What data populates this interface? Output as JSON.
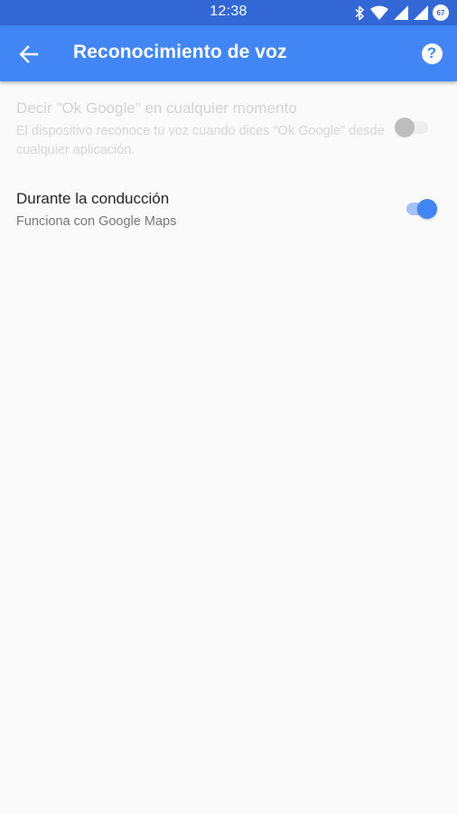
{
  "status_bar": {
    "time": "12:38",
    "battery_level": "67",
    "icons": [
      "bluetooth-icon",
      "wifi-icon",
      "signal-icon",
      "signal-icon",
      "battery-icon"
    ]
  },
  "app_bar": {
    "title": "Reconocimiento de voz",
    "back_icon": "arrow-back-icon",
    "help_icon": "help-icon",
    "help_glyph": "?"
  },
  "settings": [
    {
      "title": "Decir \"Ok Google\" en cualquier momento",
      "subtitle": "El dispositivo reconoce tu voz cuando dices \"Ok Google\" desde cualquier aplicación.",
      "enabled": false,
      "toggle_on": false
    },
    {
      "title": "Durante la conducción",
      "subtitle": "Funciona con Google Maps",
      "enabled": true,
      "toggle_on": true
    }
  ],
  "colors": {
    "status_bar": "#3367d6",
    "app_bar": "#4285f4",
    "background": "#fafafa",
    "accent": "#4285f4"
  }
}
